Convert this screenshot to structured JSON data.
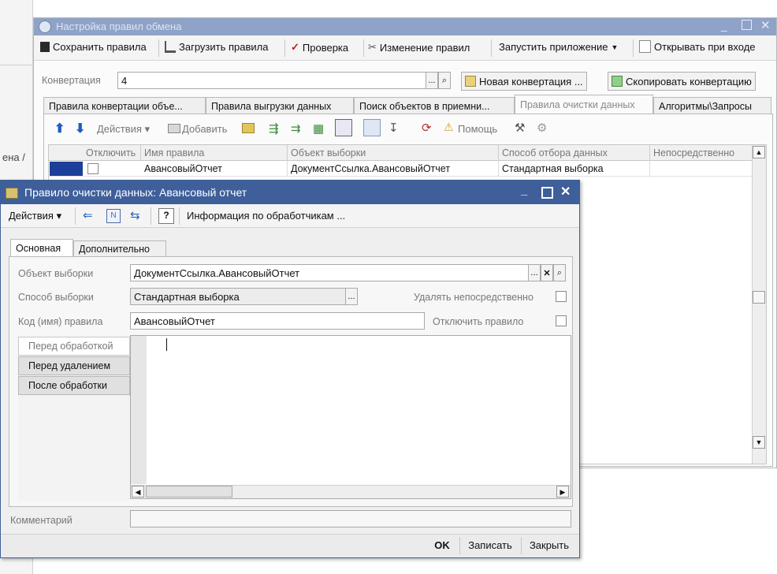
{
  "back_window": {
    "title": "Настройка правил обмена",
    "toolbar": {
      "save": "Сохранить правила",
      "load": "Загрузить правила",
      "check": "Проверка",
      "edit": "Изменение правил",
      "run_app": "Запустить приложение",
      "open_on_start": "Открывать при входе"
    },
    "conversion_label": "Конвертация",
    "conversion_value": "4",
    "new_conversion": "Новая конвертация ...",
    "copy_conversion": "Скопировать конвертацию",
    "tabs": [
      "Правила конвертации объе...",
      "Правила выгрузки данных",
      "Поиск объектов в приемни...",
      "Правила очистки данных",
      "Алгоритмы\\Запросы"
    ],
    "inner_toolbar": {
      "actions": "Действия",
      "add": "Добавить",
      "help": "Помощь"
    },
    "grid": {
      "headers": [
        "Отключить",
        "Имя правила",
        "Объект выборки",
        "Способ отбора данных",
        "Непосредственно"
      ],
      "rows": [
        [
          "",
          "АвансовыйОтчет",
          "ДокументСсылка.АвансовыйОтчет",
          "Стандартная выборка",
          ""
        ]
      ]
    }
  },
  "left_fragment": {
    "text": "ена /"
  },
  "dialog": {
    "title": "Правило очистки данных: Авансовый отчет",
    "toolbar": {
      "actions": "Действия",
      "handlers_info": "Информация по обработчикам ..."
    },
    "tabs": [
      "Основная",
      "Дополнительно"
    ],
    "object_label": "Объект выборки",
    "object_value": "ДокументСсылка.АвансовыйОтчет",
    "method_label": "Способ выборки",
    "method_value": "Стандартная выборка",
    "delete_direct_label": "Удалять непосредственно",
    "code_label": "Код (имя) правила",
    "code_value": "АвансовыйОтчет",
    "disable_label": "Отключить правило",
    "handlers": [
      "Перед обработкой",
      "Перед удалением",
      "После обработки"
    ],
    "comment_label": "Комментарий",
    "buttons": {
      "ok": "OK",
      "save": "Записать",
      "close": "Закрыть"
    }
  },
  "colors": {
    "back_title": "#8fa3c8",
    "dialog_title": "#3f5f9a",
    "accent_selected": "#1c3f9a"
  }
}
